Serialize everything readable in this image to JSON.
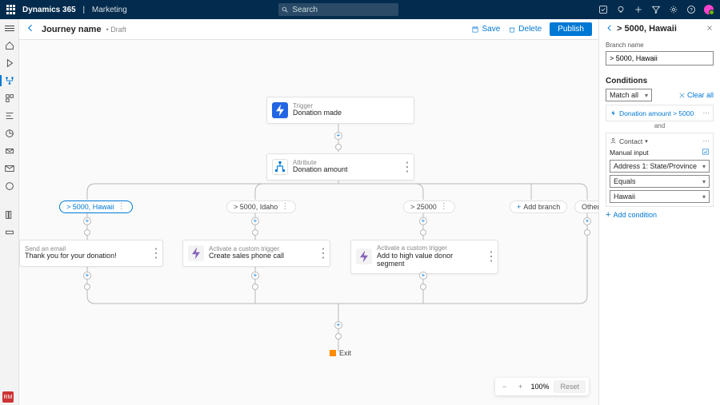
{
  "app": {
    "name": "Dynamics 365",
    "area": "Marketing",
    "search_placeholder": "Search"
  },
  "header": {
    "title": "Journey name",
    "status": "• Draft",
    "save": "Save",
    "delete": "Delete",
    "publish": "Publish"
  },
  "flow": {
    "trigger": {
      "label": "Trigger",
      "name": "Donation made"
    },
    "attribute": {
      "label": "Attribute",
      "name": "Donation amount"
    },
    "branches": [
      {
        "label": "> 5000, Hawaii",
        "selected": true
      },
      {
        "label": "> 5000, Idaho",
        "selected": false
      },
      {
        "label": "> 25000",
        "selected": false
      }
    ],
    "add_branch": "Add branch",
    "other": "Other",
    "actions": [
      {
        "label": "Send an email",
        "name": "Thank you for your donation!"
      },
      {
        "label": "Activate a custom trigger",
        "name": "Create sales phone call"
      },
      {
        "label": "Activate a custom trigger",
        "name": "Add to high value donor segment"
      }
    ],
    "exit": "Exit"
  },
  "zoom": {
    "level": "100%",
    "reset": "Reset"
  },
  "panel": {
    "title": "> 5000, Hawaii",
    "branch_name_label": "Branch name",
    "branch_name_value": "> 5000, Hawaii",
    "conditions_title": "Conditions",
    "match": "Match all",
    "clear_all": "Clear all",
    "condition1": "Donation amount > 5000",
    "and": "and",
    "contact": "Contact",
    "manual_input": "Manual input",
    "field": "Address 1: State/Province",
    "operator": "Equals",
    "value": "Hawaii",
    "add_condition": "Add condition"
  },
  "corner_badge": "RM"
}
